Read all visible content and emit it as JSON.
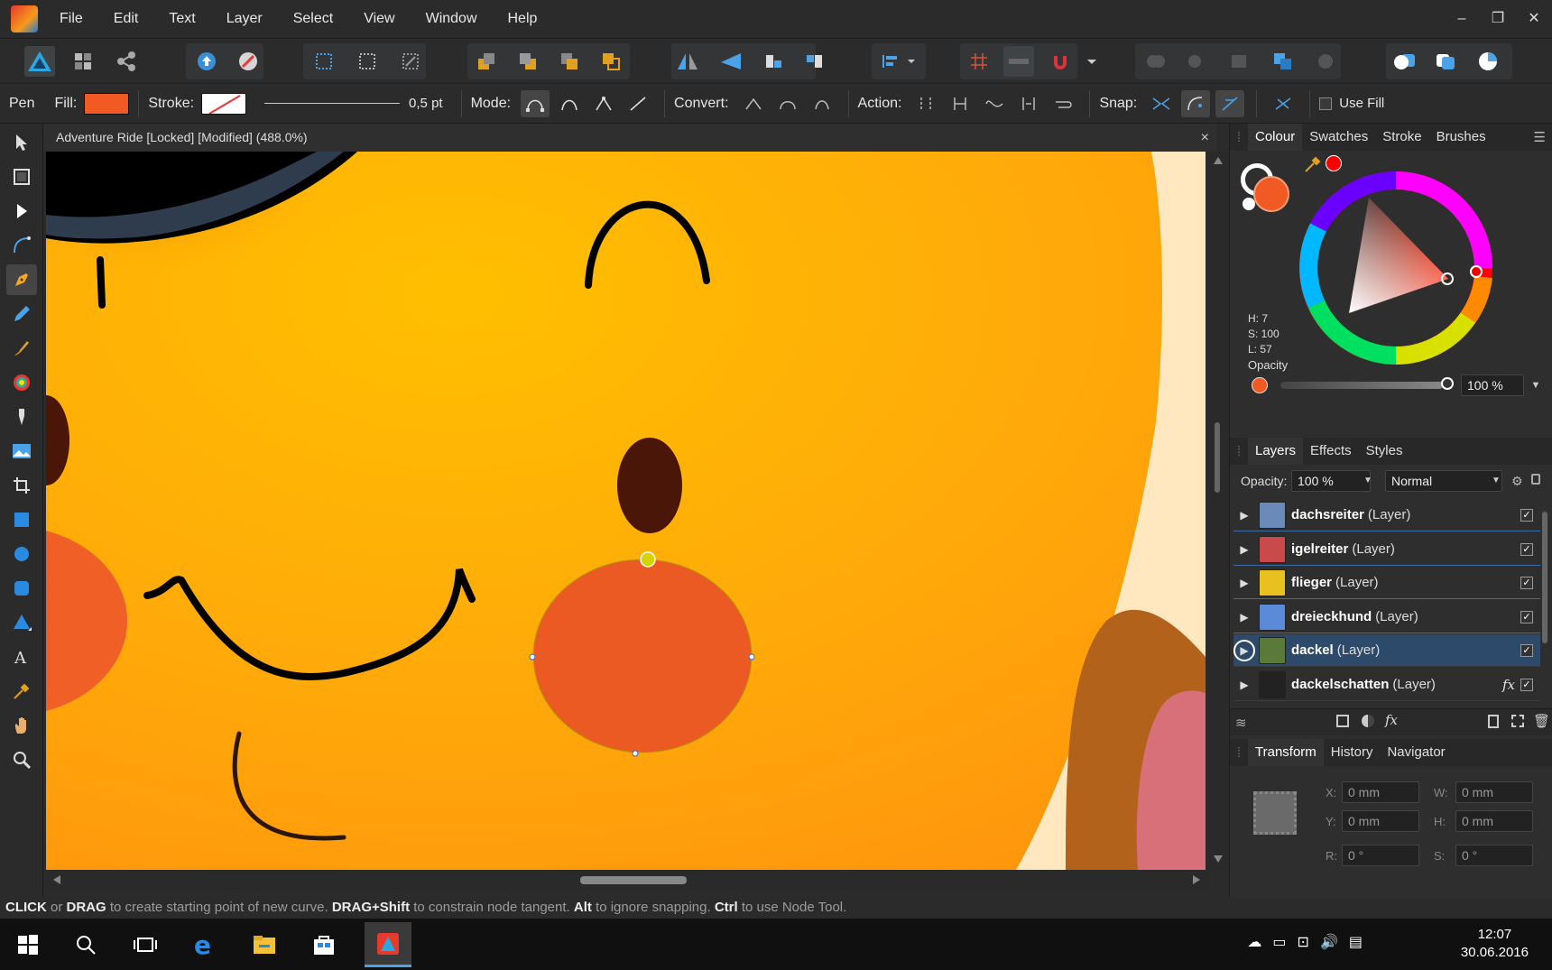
{
  "menu": [
    "File",
    "Edit",
    "Text",
    "Layer",
    "Select",
    "View",
    "Window",
    "Help"
  ],
  "window_controls": {
    "minimize": "–",
    "restore": "❐",
    "close": "✕"
  },
  "context": {
    "tool_name": "Pen",
    "fill_label": "Fill:",
    "stroke_label": "Stroke:",
    "stroke_width": "0,5 pt",
    "mode_label": "Mode:",
    "convert_label": "Convert:",
    "action_label": "Action:",
    "snap_label": "Snap:",
    "use_fill_label": "Use Fill",
    "fill_color": "#f15a22"
  },
  "document": {
    "title": "Adventure Ride [Locked] [Modified] (488.0%)",
    "close": "×"
  },
  "colour_panel": {
    "tabs": [
      "Colour",
      "Swatches",
      "Stroke",
      "Brushes"
    ],
    "h": "H: 7",
    "s": "S: 100",
    "l": "L: 57",
    "opacity_label": "Opacity",
    "opacity_value": "100 %",
    "current_color": "#f15a22",
    "secondary_color": "#ff0000"
  },
  "layers_panel": {
    "tabs": [
      "Layers",
      "Effects",
      "Styles"
    ],
    "opacity_label": "Opacity:",
    "opacity_value": "100 %",
    "blend_mode": "Normal",
    "fx_label": "fx",
    "layers": [
      {
        "name": "dachsreiter",
        "type": "(Layer)"
      },
      {
        "name": "igelreiter",
        "type": "(Layer)"
      },
      {
        "name": "flieger",
        "type": "(Layer)"
      },
      {
        "name": "dreieckhund",
        "type": "(Layer)"
      },
      {
        "name": "dackel",
        "type": "(Layer)"
      },
      {
        "name": "dackelschatten",
        "type": "(Layer)"
      }
    ]
  },
  "transform_panel": {
    "tabs": [
      "Transform",
      "History",
      "Navigator"
    ],
    "x_label": "X:",
    "x_value": "0 mm",
    "y_label": "Y:",
    "y_value": "0 mm",
    "w_label": "W:",
    "w_value": "0 mm",
    "h_label": "H:",
    "h_value": "0 mm",
    "r_label": "R:",
    "r_value": "0 °",
    "s_label": "S:",
    "s_value": "0 °"
  },
  "status": {
    "click": "CLICK",
    "or": " or ",
    "drag": "DRAG",
    "t1": " to create starting point of new curve. ",
    "dragshift": "DRAG+Shift",
    "t2": " to constrain node tangent. ",
    "alt": "Alt",
    "t3": " to ignore snapping. ",
    "ctrl": "Ctrl",
    "t4": " to use Node Tool."
  },
  "taskbar": {
    "time": "12:07",
    "date": "30.06.2016"
  }
}
